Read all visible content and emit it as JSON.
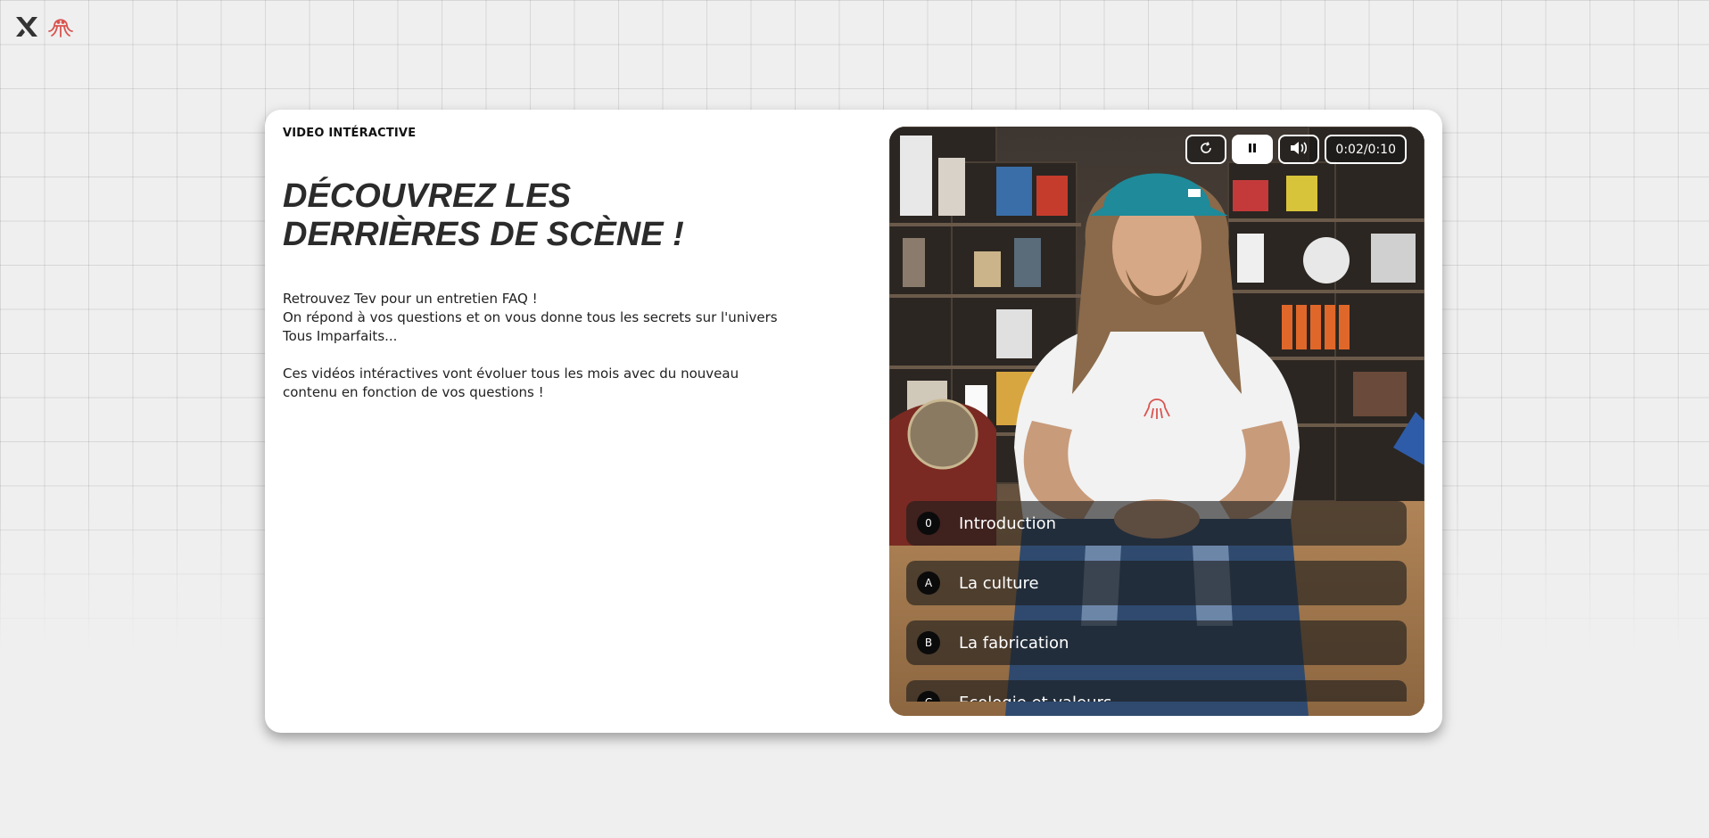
{
  "header": {
    "logo_icons": [
      "x-logo-icon",
      "octopus-logo-icon"
    ]
  },
  "card": {
    "eyebrow": "VIDEO INTÉRACTIVE",
    "title_line1": "DÉCOUVREZ LES",
    "title_line2": "DERRIÈRES DE SCÈNE !",
    "paragraph1": "Retrouvez Tev pour un entretien FAQ !\nOn répond à vos questions et on vous donne tous les secrets sur l'univers Tous Imparfaits...",
    "paragraph2": "Ces vidéos intéractives vont évoluer tous les mois avec du nouveau contenu en fonction de vos questions !"
  },
  "video": {
    "controls": {
      "replay_icon": "replay-icon",
      "pause_icon": "pause-icon",
      "volume_icon": "volume-icon",
      "time": "0:02/0:10"
    },
    "chapters": [
      {
        "badge": "0",
        "label": "Introduction"
      },
      {
        "badge": "A",
        "label": "La culture"
      },
      {
        "badge": "B",
        "label": "La fabrication"
      },
      {
        "badge": "C",
        "label": "Ecologie et valeurs"
      }
    ]
  },
  "colors": {
    "background": "#efefef",
    "card": "#ffffff",
    "title": "#2b2b2b",
    "logo_red": "#d9534f",
    "logo_dark": "#333333"
  }
}
